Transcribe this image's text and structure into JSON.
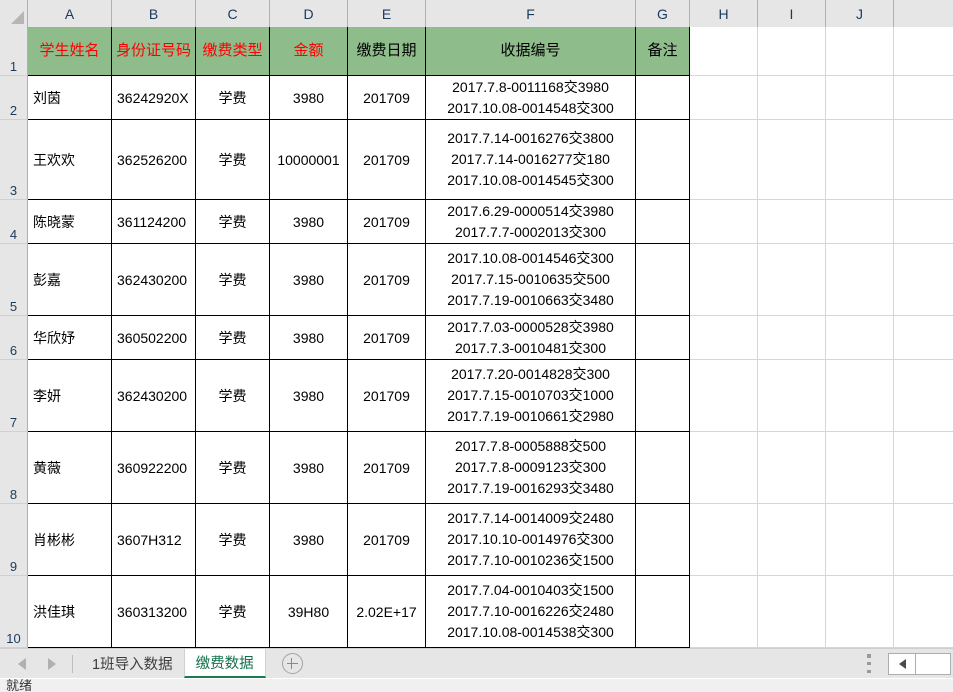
{
  "app": {
    "status_text": "就绪"
  },
  "grid": {
    "corner_icon": "select-all-triangle",
    "column_headers": [
      "A",
      "B",
      "C",
      "D",
      "E",
      "F",
      "G",
      "H",
      "I",
      "J"
    ],
    "row_headers": [
      "1",
      "2",
      "3",
      "4",
      "5",
      "6",
      "7",
      "8",
      "9",
      "10"
    ],
    "header_row": {
      "A": "学生姓名",
      "B": "身份证号码",
      "C": "缴费类型",
      "D": "金额",
      "E": "缴费日期",
      "F": "收据编号",
      "G": "备注"
    },
    "header_colors": {
      "fill": "#8fbc8b",
      "red_text": "#ff0000",
      "black_text": "#000000"
    },
    "rows": [
      {
        "row": "2",
        "A": "刘茵",
        "B": "36242920X",
        "B_error_flag": false,
        "C": "学费",
        "D": "3980",
        "E": "201709",
        "F": [
          "2017.7.8-0011168交3980",
          "2017.10.08-0014548交300"
        ],
        "G": ""
      },
      {
        "row": "3",
        "A": "王欢欢",
        "B": "362526200",
        "B_error_flag": true,
        "C": "学费",
        "D": "10000001",
        "E": "201709",
        "F": [
          "2017.7.14-0016276交3800",
          "2017.7.14-0016277交180",
          "2017.10.08-0014545交300"
        ],
        "G": ""
      },
      {
        "row": "4",
        "A": "陈晓蒙",
        "B": "361124200",
        "B_error_flag": false,
        "C": "学费",
        "D": "3980",
        "E": "201709",
        "F": [
          "2017.6.29-0000514交3980",
          "2017.7.7-0002013交300"
        ],
        "G": ""
      },
      {
        "row": "5",
        "A": "彭嘉",
        "B": "362430200",
        "B_error_flag": true,
        "C": "学费",
        "D": "3980",
        "E": "201709",
        "F": [
          "2017.10.08-0014546交300",
          "2017.7.15-0010635交500",
          "2017.7.19-0010663交3480"
        ],
        "G": ""
      },
      {
        "row": "6",
        "A": "华欣妤",
        "B": "360502200",
        "B_error_flag": true,
        "C": "学费",
        "D": "3980",
        "E": "201709",
        "F": [
          "2017.7.03-0000528交3980",
          "2017.7.3-0010481交300"
        ],
        "G": ""
      },
      {
        "row": "7",
        "A": "李妍",
        "B": "362430200",
        "B_error_flag": false,
        "C": "学费",
        "D": "3980",
        "E": "201709",
        "F": [
          "2017.7.20-0014828交300",
          "2017.7.15-0010703交1000",
          "2017.7.19-0010661交2980"
        ],
        "G": ""
      },
      {
        "row": "8",
        "A": "黄薇",
        "B": "360922200",
        "B_error_flag": true,
        "C": "学费",
        "D": "3980",
        "E": "201709",
        "F": [
          "2017.7.8-0005888交500",
          "2017.7.8-0009123交300",
          "2017.7.19-0016293交3480"
        ],
        "G": ""
      },
      {
        "row": "9",
        "A": "肖彬彬",
        "B": "3607H312",
        "B_error_flag": false,
        "C": "学费",
        "D": "3980",
        "E": "201709",
        "F": [
          "2017.7.14-0014009交2480",
          "2017.10.10-0014976交300",
          "2017.7.10-0010236交1500"
        ],
        "G": ""
      },
      {
        "row": "10",
        "A": "洪佳琪",
        "B": "360313200",
        "B_error_flag": true,
        "C": "学费",
        "D": "39H80",
        "E": "2.02E+17",
        "F": [
          "2017.7.04-0010403交1500",
          "2017.7.10-0016226交2480",
          "2017.10.08-0014538交300"
        ],
        "G": ""
      }
    ]
  },
  "sheet_tabs": {
    "prev_label": "prev-sheet",
    "next_label": "next-sheet",
    "tabs": [
      {
        "label": "1班导入数据",
        "active": false
      },
      {
        "label": "缴费数据",
        "active": true
      }
    ],
    "add_sheet_label": "new-sheet"
  }
}
